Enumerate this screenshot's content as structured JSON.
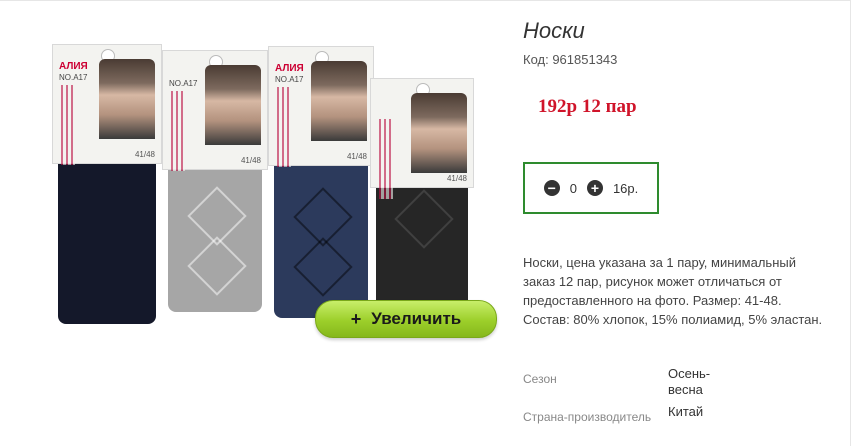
{
  "product": {
    "title": "Носки",
    "code": "Код: 961851343",
    "price": "192р 12 пар",
    "description": "Носки, цена указана за 1 пару, минимальный заказ 12 пар, рисунок может отличаться от предоставленного на фото. Размер: 41-48. Состав: 80% хлопок, 15% полиамид, 5% эластан."
  },
  "quantity": {
    "minus_icon": "minus-circle-icon",
    "plus_icon": "plus-circle-icon",
    "value": "0",
    "unit_price": "16р."
  },
  "zoom_button": {
    "icon": "+",
    "label": "Увеличить"
  },
  "properties": [
    {
      "name": "Сезон",
      "value": "Осень-весна"
    },
    {
      "name": "Страна-производитель",
      "value": "Китай"
    }
  ],
  "photo": {
    "packages": [
      {
        "brand": "АЛИЯ",
        "model": "NO.A17",
        "size": "41/48",
        "color": "#14182a"
      },
      {
        "brand": "",
        "model": "NO.A17",
        "size": "41/48",
        "color": "#a6a6a6"
      },
      {
        "brand": "АЛИЯ",
        "model": "NO.A17",
        "size": "41/48",
        "color": "#2c3a5c"
      },
      {
        "brand": "",
        "model": "",
        "size": "41/48",
        "color": "#262626"
      }
    ]
  },
  "colors": {
    "price": "#d0142a",
    "qty_border": "#2e8b2e",
    "button_green": "#9ccf2a"
  }
}
